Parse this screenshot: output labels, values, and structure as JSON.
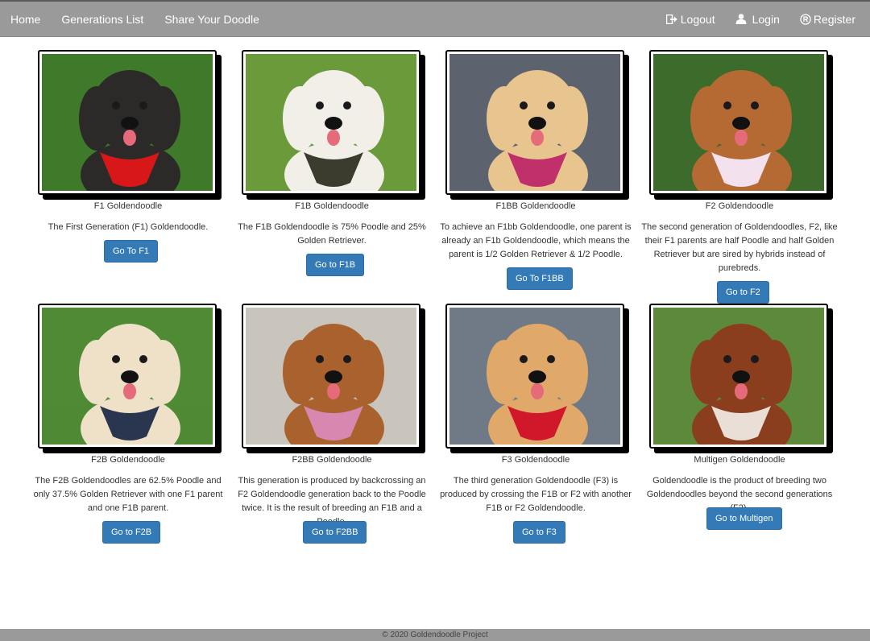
{
  "nav": {
    "home": "Home",
    "generations_list": "Generations List",
    "share": "Share Your Doodle",
    "logout": "Logout",
    "login": "Login",
    "register": "Register"
  },
  "cards": [
    {
      "title": "F1 Goldendoodle",
      "desc": "The First Generation (F1) Goldendoodle.",
      "button": "Go To F1",
      "icon": "dog-photo-black",
      "fur": "#2c2a28",
      "bg": "#3f7a2a",
      "accent": "#d81818"
    },
    {
      "title": "F1B Goldendoodle",
      "desc": "The F1B Goldendoodle is 75% Poodle and 25% Golden Retriever.",
      "button": "Go to F1B",
      "icon": "dog-photo-white",
      "fur": "#f2efe8",
      "bg": "#6b9a3a",
      "accent": "#3c3c2e"
    },
    {
      "title": "F1BB Goldendoodle",
      "desc": "To achieve an F1bb Goldendoodle, one parent is already an F1b Goldendoodle, which means the parent is 1/2 Golden Retriever & 1/2 Poodle.",
      "button": "Go To F1BB",
      "icon": "dog-photo-cream",
      "fur": "#e8c48e",
      "bg": "#5c636e",
      "accent": "#c0306a"
    },
    {
      "title": "F2 Goldendoodle",
      "desc": "The second generation of Goldendoodles, F2, like their F1 parents are half Poodle and half Golden Retriever but are sired by hybrids instead of purebreds.",
      "button": "Go to F2",
      "icon": "dog-photo-apricot",
      "fur": "#b56a34",
      "bg": "#3d6b2c",
      "accent": "#f3e2ee"
    },
    {
      "title": "F2B Goldendoodle",
      "desc": "The F2B Goldendoodles are 62.5% Poodle and only 37.5% Golden Retriever with one F1 parent and one F1B parent.",
      "button": "Go to F2B",
      "icon": "dog-photo-cream-lying",
      "fur": "#efe0c8",
      "bg": "#4f8a35",
      "accent": "#2a3550"
    },
    {
      "title": "F2BB Goldendoodle",
      "desc": "This generation is produced by backcrossing an F2 Goldendoodle generation back to the Poodle twice. It is the result of breeding an F1B and a Poodle.",
      "button": "Go to F2BB",
      "icon": "dog-photo-red",
      "fur": "#a9622e",
      "bg": "#c9c4bc",
      "accent": "#d888b0"
    },
    {
      "title": "F3 Goldendoodle",
      "desc": "The third generation Goldendoodle (F3) is produced by crossing the F1B or F2 with another F1B or F2 Goldendoodle.",
      "button": "Go to F3",
      "icon": "dog-photo-golden",
      "fur": "#e0a96a",
      "bg": "#6f7a86",
      "accent": "#d0182a"
    },
    {
      "title": "Multigen Goldendoodle",
      "desc": "Goldendoodle is the product of breeding two Goldendoodles beyond the second generations (F2).",
      "button": "Go to Multigen",
      "icon": "dog-photo-brown",
      "fur": "#8a3e1e",
      "bg": "#5d8a3a",
      "accent": "#e9dfd6"
    }
  ],
  "footer": "© 2020 Goldendoodle Project"
}
